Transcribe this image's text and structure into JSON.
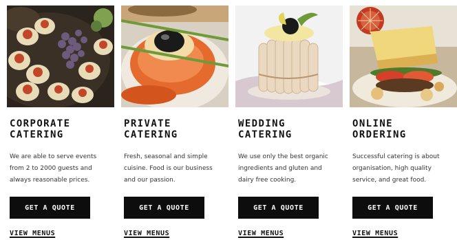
{
  "services": [
    {
      "image": "corporate-catering-photo",
      "title": "CORPORATE\nCATERING",
      "description": "We are able to serve events from 2 to 2000 guests and always reasonable prices.",
      "button_label": "GET A QUOTE",
      "link_label": "VIEW MENUS"
    },
    {
      "image": "private-catering-photo",
      "title": "PRIVATE\nCATERING",
      "description": "Fresh, seasonal and simple cuisine. Food is our business and our passion.",
      "button_label": "GET A QUOTE",
      "link_label": "VIEW MENUS"
    },
    {
      "image": "wedding-catering-photo",
      "title": "WEDDING\nCATERING",
      "description": "We use only the best organic ingredients and gluten and dairy free cooking.",
      "button_label": "GET A QUOTE",
      "link_label": "VIEW MENUS"
    },
    {
      "image": "online-ordering-photo",
      "title": "ONLINE\nORDERING",
      "description": "Successful catering is about organisation, high quality service, and great food.",
      "button_label": "GET A QUOTE",
      "link_label": "VIEW MENUS"
    }
  ],
  "colors": {
    "button_bg": "#0d0d0d",
    "button_text": "#ffffff",
    "text": "#333333",
    "heading": "#111111"
  }
}
